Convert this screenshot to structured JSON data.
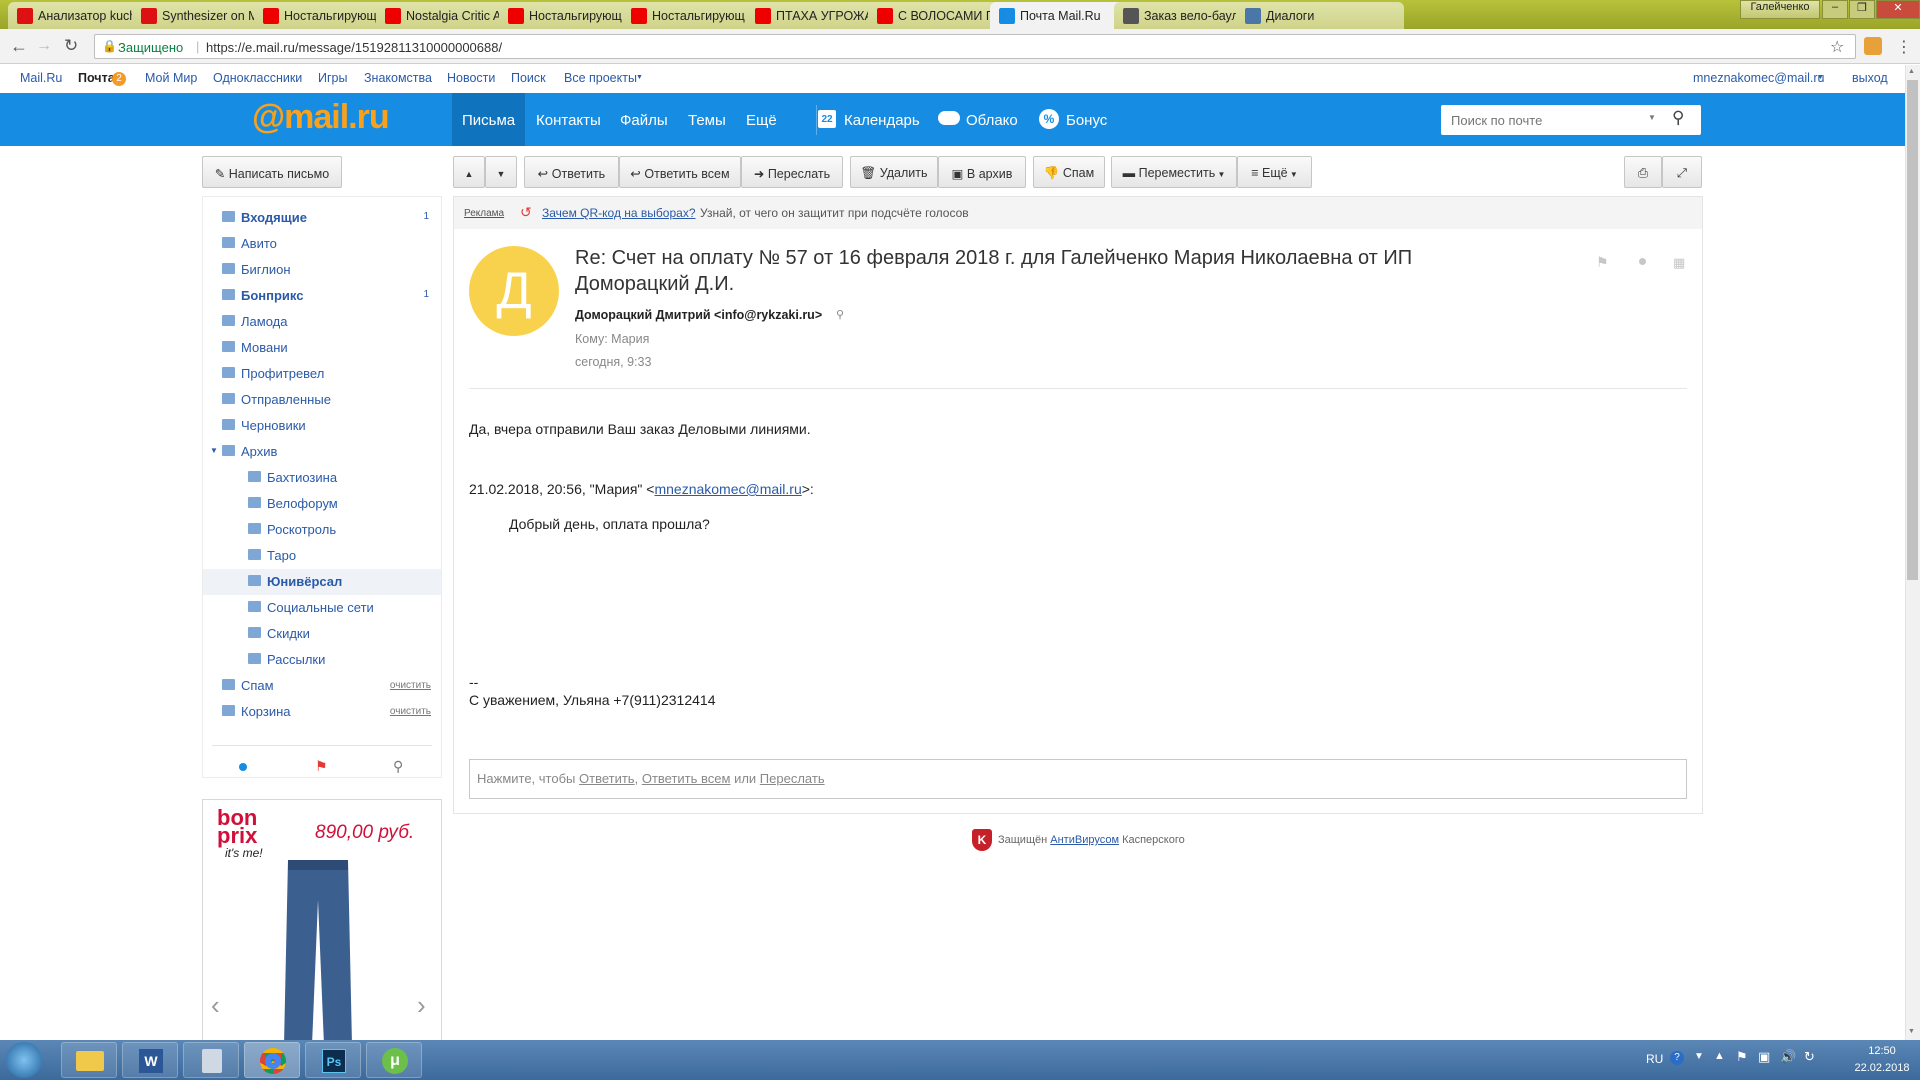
{
  "browser": {
    "tabs": [
      {
        "label": "Анализатор kuch",
        "icon": "seo-icon",
        "color": "#d11"
      },
      {
        "label": "Synthesizer on M",
        "icon": "seo-icon",
        "color": "#d11"
      },
      {
        "label": "Ностальгирующ",
        "icon": "youtube-icon",
        "color": "#e00"
      },
      {
        "label": "Nostalgia Critic A",
        "icon": "youtube-icon",
        "color": "#e00"
      },
      {
        "label": "Ностальгирующ",
        "icon": "youtube-icon",
        "color": "#e00"
      },
      {
        "label": "Ностальгирующ",
        "icon": "youtube-icon",
        "color": "#e00"
      },
      {
        "label": "ПТАХА УГРОЖАЕ",
        "icon": "youtube-icon",
        "color": "#e00"
      },
      {
        "label": "С ВОЛОСАМИ П",
        "icon": "youtube-icon",
        "color": "#e00"
      },
      {
        "label": "Почта Mail.Ru",
        "icon": "mailru-icon",
        "color": "#168de2"
      },
      {
        "label": "Заказ вело-баул",
        "icon": "bicycle-icon",
        "color": "#555"
      },
      {
        "label": "Диалоги",
        "icon": "chat-icon",
        "color": "#4a76a8"
      }
    ],
    "user_chip": "Галейченко",
    "secure_label": "Защищено",
    "url": "https://e.mail.ru/message/15192811310000000688/"
  },
  "portal": {
    "links": [
      "Mail.Ru",
      "Почта",
      "Мой Мир",
      "Одноклассники",
      "Игры",
      "Знакомства",
      "Новости",
      "Поиск",
      "Все проекты"
    ],
    "mail_badge": "2",
    "account": "mneznakomec@mail.ru",
    "logout": "выход"
  },
  "header": {
    "logo": "@mail.ru",
    "nav": [
      "Письма",
      "Контакты",
      "Файлы",
      "Темы",
      "Ещё"
    ],
    "calendar_day": "22",
    "services": [
      "Календарь",
      "Облако",
      "Бонус"
    ],
    "search_placeholder": "Поиск по почте"
  },
  "toolbar": {
    "compose": "Написать письмо",
    "reply": "Ответить",
    "reply_all": "Ответить всем",
    "forward": "Переслать",
    "delete": "Удалить",
    "archive": "В архив",
    "spam": "Спам",
    "move": "Переместить",
    "more": "Ещё"
  },
  "folders": [
    {
      "label": "Входящие",
      "count": "1",
      "bold": true
    },
    {
      "label": "Авито"
    },
    {
      "label": "Биглион"
    },
    {
      "label": "Бонприкс",
      "count": "1",
      "bold": true
    },
    {
      "label": "Ламода"
    },
    {
      "label": "Мовани"
    },
    {
      "label": "Профитревел"
    },
    {
      "label": "Отправленные"
    },
    {
      "label": "Черновики"
    },
    {
      "label": "Архив"
    },
    {
      "label": "Бахтиозина",
      "sub": true
    },
    {
      "label": "Велофорум",
      "sub": true
    },
    {
      "label": "Роскотроль",
      "sub": true
    },
    {
      "label": "Таро",
      "sub": true
    },
    {
      "label": "Юнивёрсал",
      "sub": true,
      "bold": true,
      "selected": true
    },
    {
      "label": "Социальные сети",
      "sub": true
    },
    {
      "label": "Скидки",
      "sub": true
    },
    {
      "label": "Рассылки",
      "sub": true
    },
    {
      "label": "Спам",
      "clear": "очистить"
    },
    {
      "label": "Корзина",
      "clear": "очистить"
    }
  ],
  "ad": {
    "brand_line1": "bon",
    "brand_line2": "prix",
    "brand_tagline": "it's me!",
    "price": "890,00 руб."
  },
  "message": {
    "ad_label": "Реклама",
    "ad_link": "Зачем QR-код на выборах?",
    "ad_text": "Узнай, от чего он защитит при подсчёте голосов",
    "avatar_letter": "Д",
    "subject_line1": "Re: Счет на оплату № 57 от 16 февраля 2018 г. для Галейченко Мария Николаевна от ИП",
    "subject_line2": "Доморацкий Д.И.",
    "from": "Доморацкий Дмитрий <info@rykzaki.ru>",
    "to": "Кому: Мария",
    "date": "сегодня, 9:33",
    "body1": "Да, вчера отправили Ваш заказ Деловыми линиями.",
    "quote_header_pre": "21.02.2018, 20:56, \"Мария\" <",
    "quote_email": "mneznakomec@mail.ru",
    "quote_header_post": ">:",
    "quote_body": "Добрый день, оплата прошла?",
    "sig_dash": "--",
    "signature": "С уважением, Ульяна +7(911)2312414",
    "reply_prompt": "Нажмите, чтобы",
    "reply_link1": "Ответить",
    "reply_link2": "Ответить всем",
    "reply_or": "или",
    "reply_link3": "Переслать",
    "av_pre": "Защищён",
    "av_link": "АнтиВирусом",
    "av_post": "Касперского"
  },
  "taskbar": {
    "lang": "RU",
    "time": "12:50",
    "date": "22.02.2018"
  }
}
